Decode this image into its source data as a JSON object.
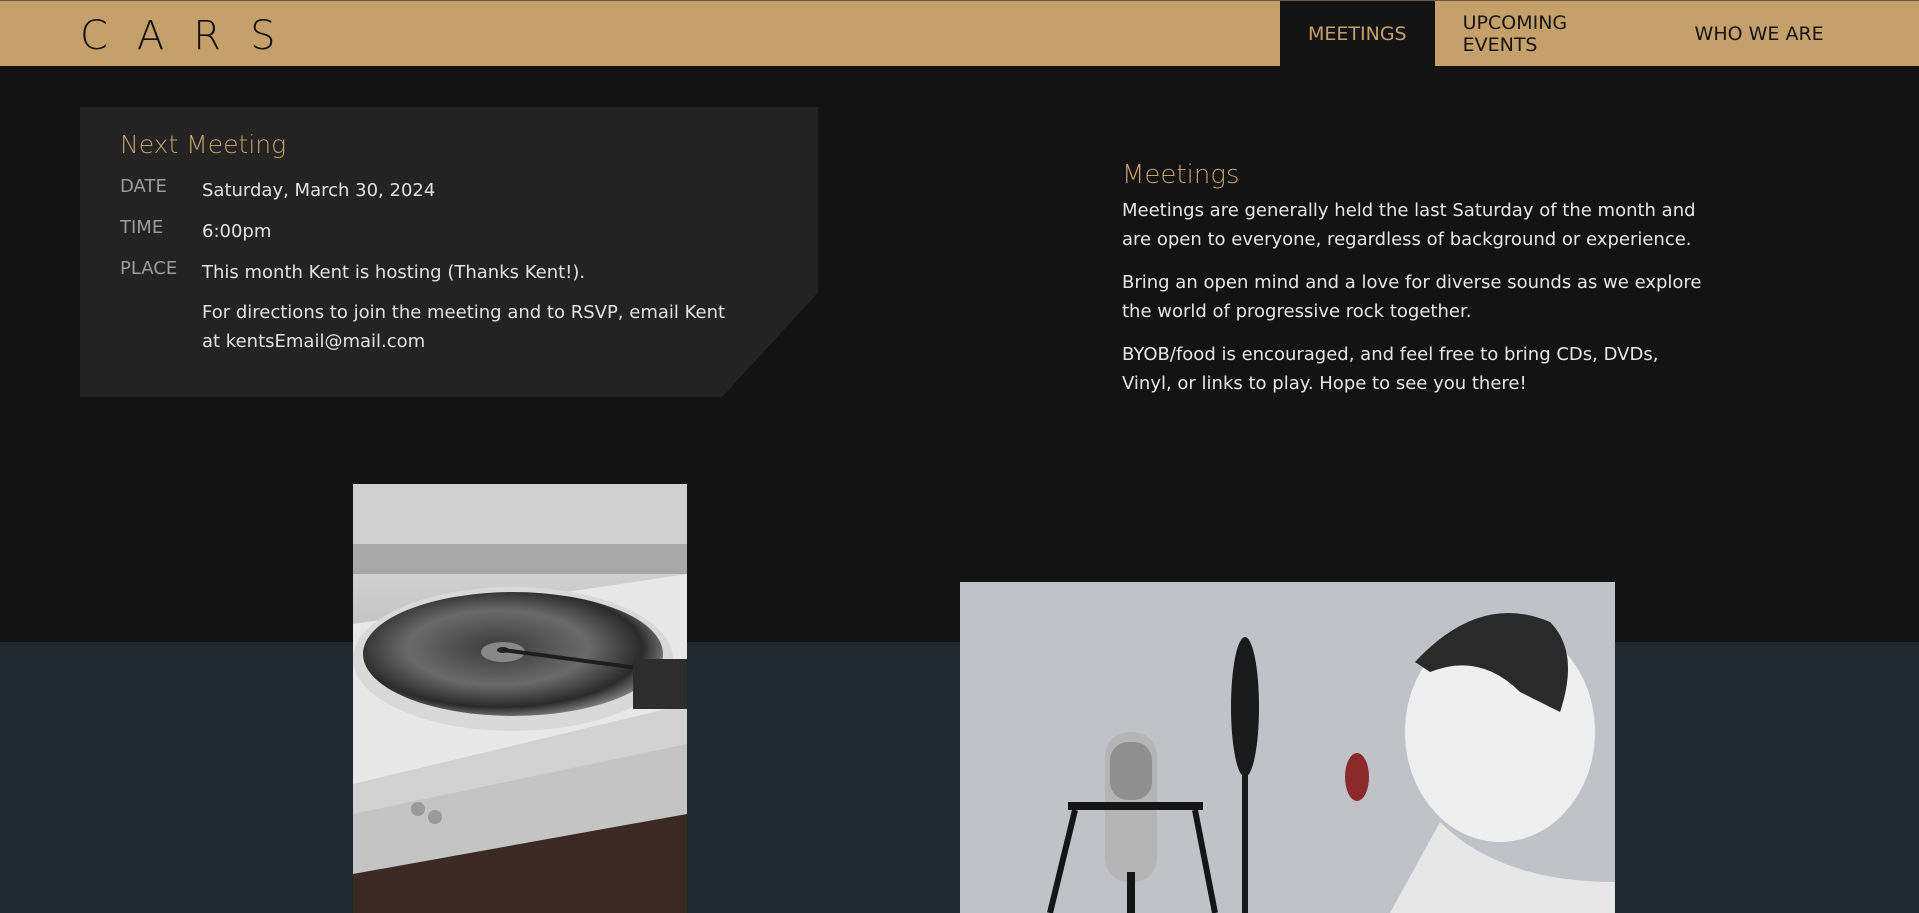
{
  "header": {
    "brand": "CARS",
    "nav": [
      {
        "label": "MEETINGS",
        "active": true
      },
      {
        "label": "UPCOMING EVENTS",
        "active": false
      },
      {
        "label": "WHO WE ARE",
        "active": false
      }
    ]
  },
  "next_meeting": {
    "title": "Next Meeting",
    "date_label": "DATE",
    "date_value": "Saturday, March 30, 2024",
    "time_label": "TIME",
    "time_value": "6:00pm",
    "place_label": "PLACE",
    "place_value": "This month Kent is hosting (Thanks Kent!).",
    "directions": "For directions to join the meeting and to RSVP, email Kent at kentsEmail@mail.com"
  },
  "meetings_info": {
    "title": "Meetings",
    "paragraphs": [
      "Meetings are generally held the last Saturday of the month and are open to everyone, regardless of background or experience.",
      "Bring an open mind and a love for diverse sounds as we explore the world of progressive rock together.",
      "BYOB/food is encouraged, and feel free to bring CDs, DVDs, Vinyl, or links to play. Hope to see you there!"
    ]
  },
  "colors": {
    "accent": "#c6a06a",
    "background": "#131314",
    "card": "#232323",
    "lower_band": "#202830"
  }
}
